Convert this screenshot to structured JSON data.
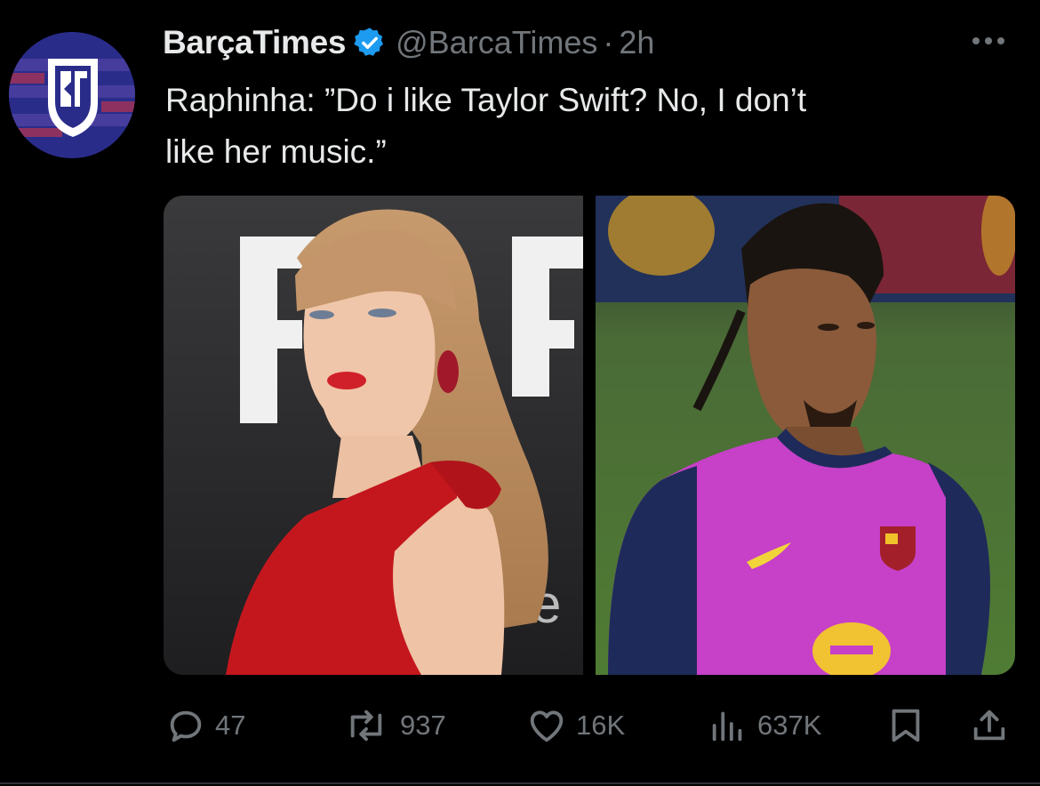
{
  "tweet": {
    "display_name": "BarçaTimes",
    "handle": "@BarcaTimes",
    "separator": "·",
    "time": "2h",
    "text_line1": "Raphinha: ”Do i like Taylor Swift? No, I don’t",
    "text_line2": "like her music.”",
    "verified_color": "#1d9bf0"
  },
  "avatar": {
    "icon": "barcatimes-logo",
    "bg_color": "#2a2c8a"
  },
  "media": {
    "left_image": "photo-taylor-swift-red-dress",
    "right_image": "photo-raphinha-pink-training-shirt"
  },
  "actions": {
    "replies": "47",
    "reposts": "937",
    "likes": "16K",
    "views": "637K"
  },
  "icons": {
    "reply": "reply-icon",
    "repost": "repost-icon",
    "like": "heart-icon",
    "views": "views-icon",
    "bookmark": "bookmark-icon",
    "share": "share-icon",
    "more": "more-icon"
  }
}
